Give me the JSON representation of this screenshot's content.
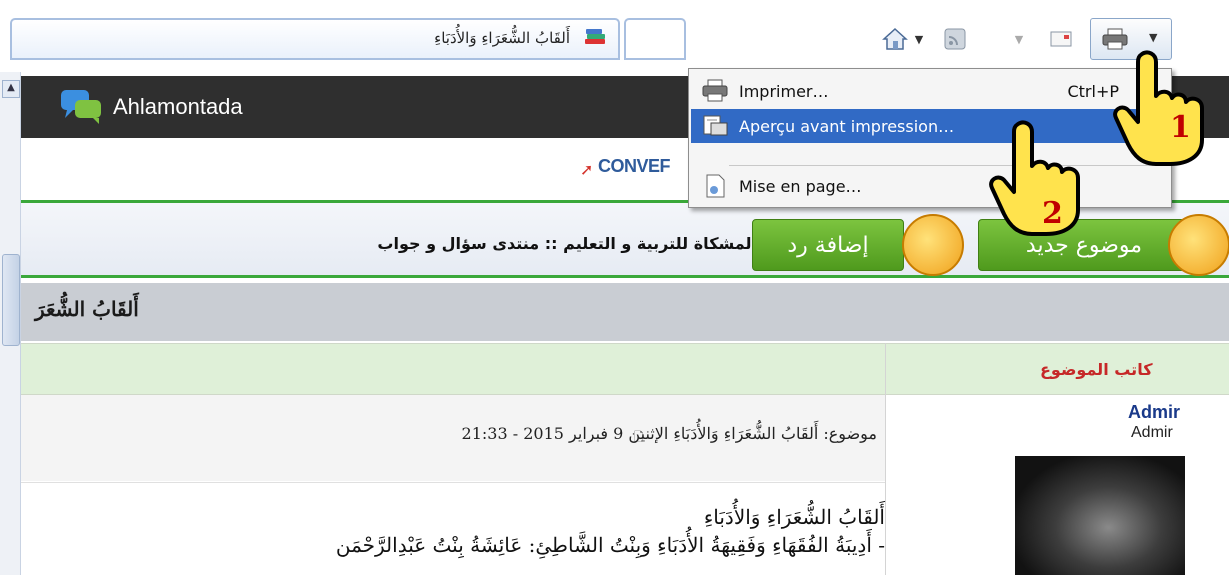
{
  "browser": {
    "tab": {
      "title": "أَلقَابُ الشُّعَرَاءِ وَالأُدَبَاءِ",
      "favicon": "books-favicon-icon"
    },
    "toolbar": {
      "icons": [
        "home-icon",
        "feeds-icon",
        "read-mail-icon",
        "print-icon"
      ]
    }
  },
  "print_menu": {
    "items": [
      {
        "label": "Imprimer…",
        "shortcut": "Ctrl+P",
        "icon": "printer-icon"
      },
      {
        "label": "Aperçu avant impression…",
        "icon": "print-preview-icon",
        "highlighted": true
      },
      {
        "label": "Mise en page…",
        "icon": "page-setup-icon"
      }
    ]
  },
  "annotations": {
    "step1": "1",
    "step2": "2"
  },
  "site": {
    "name": "Ahlamontada",
    "convert_text": "CONVEF"
  },
  "forum": {
    "breadcrumb": "المشكاة للتربية و التعليم :: منتدى سؤال و جواب",
    "reply_button": "إضافة رد",
    "new_topic_button": "موضوع جديد",
    "topic_title": "أَلقَابُ الشُّعَرَ",
    "author_column_label": "كاتب الموضوع",
    "post": {
      "meta": "موضوع: أَلقَابُ الشُّعَرَاءِ وَالأُدَبَاءِ   الإثنين 9 فبراير 2015 - 21:33",
      "body_line1": "أَلقَابُ الشُّعَرَاءِ وَالأُدَبَاءِ",
      "body_line2": "- أَدِيبَةُ الفُقَهَاءِ وَفَقِيهَةُ الأُدَبَاءِ وَبِنْتُ الشَّاطِئِ: عَائِشَةُ بِنْتُ عَبْدِالرَّحْمَن",
      "author_name": "Admir",
      "author_rank": "Admir"
    }
  },
  "colors": {
    "menu_highlight": "#316ac5",
    "header_bg": "#2f2f2f",
    "green_button": "#5ea82a",
    "author_label": "#c62828"
  }
}
